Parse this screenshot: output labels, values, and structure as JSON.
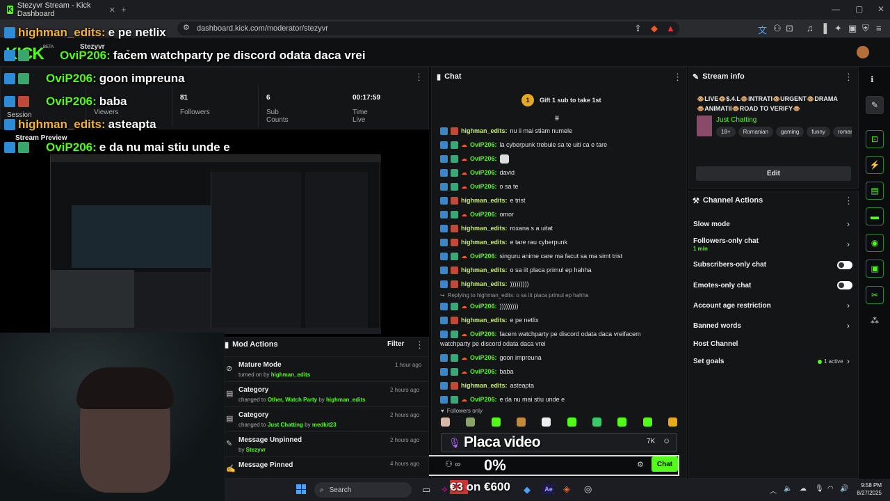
{
  "browser": {
    "tab_title": "Stezyvr Stream - Kick Dashboard",
    "url": "dashboard.kick.com/moderator/stezyvr"
  },
  "header": {
    "logo_text": "KICK",
    "beta": "BETA",
    "channel": "Stezyvr"
  },
  "session": {
    "label": "Session",
    "stats": [
      {
        "value": "",
        "label": "Viewers"
      },
      {
        "value": "81",
        "label": "Followers"
      },
      {
        "value": "6",
        "label": "Sub Counts"
      },
      {
        "value": "00:17:59",
        "label": "Time Live"
      }
    ]
  },
  "stream_preview": {
    "label": "Stream Preview"
  },
  "overlay_chat": [
    {
      "user": "highman_edits:",
      "text": "e pe netlix",
      "color": "orange"
    },
    {
      "user": "OviP206:",
      "text": "facem watchparty pe discord odata daca vrei",
      "color": "green"
    },
    {
      "user": "OviP206:",
      "text": "goon impreuna",
      "color": "green"
    },
    {
      "user": "OviP206:",
      "text": "baba",
      "color": "green"
    },
    {
      "user": "highman_edits:",
      "text": "asteapta",
      "color": "orange"
    },
    {
      "user": "OviP206:",
      "text": "e da nu mai stiu unde e",
      "color": "green"
    }
  ],
  "chat": {
    "title": "Chat",
    "gift_banner": "Gift 1 sub to take 1st",
    "gift_rank": "1",
    "messages": [
      {
        "user": "highman_edits:",
        "text": "nu ii mai stiam numele",
        "type": "y"
      },
      {
        "user": "OviP206:",
        "text": "la cyberpunk trebuie sa te uiti ca e tare",
        "type": "g"
      },
      {
        "user": "OviP206:",
        "text": "",
        "type": "g"
      },
      {
        "user": "OviP206:",
        "text": "david",
        "type": "g"
      },
      {
        "user": "OviP206:",
        "text": "o sa te",
        "type": "g"
      },
      {
        "user": "highman_edits:",
        "text": "e trist",
        "type": "y"
      },
      {
        "user": "OviP206:",
        "text": "omor",
        "type": "g"
      },
      {
        "user": "highman_edits:",
        "text": "roxana s a uitat",
        "type": "y"
      },
      {
        "user": "highman_edits:",
        "text": "e tare rau cyberpunk",
        "type": "y"
      },
      {
        "user": "OviP206:",
        "text": "singuru anime care ma facut sa ma simt trist",
        "type": "g"
      },
      {
        "user": "highman_edits:",
        "text": "o sa iit placa primul ep hahha",
        "type": "y"
      },
      {
        "user": "highman_edits:",
        "text": ")))))))))",
        "type": "y"
      }
    ],
    "reply_to": "Replying to highman_edits: o sa iit placa primul ep hahha",
    "reply_msg": {
      "user": "OviP206:",
      "text": ")))))))))"
    },
    "messages2": [
      {
        "user": "highman_edits:",
        "text": "e pe netlix",
        "type": "y"
      }
    ],
    "long_msg": {
      "user": "OviP206:",
      "line1": "facem watchparty pe discord odata daca vreifacem",
      "line2": "watchparty pe discord odata daca vrei"
    },
    "messages3": [
      {
        "user": "OviP206:",
        "text": "goon impreuna",
        "type": "g"
      },
      {
        "user": "OviP206:",
        "text": "baba",
        "type": "g"
      },
      {
        "user": "highman_edits:",
        "text": "asteapta",
        "type": "y"
      },
      {
        "user": "OviP206:",
        "text": "e da nu mai stiu unde e",
        "type": "g"
      }
    ],
    "followers_only": "Followers only",
    "send_label": "Chat"
  },
  "overlay_widgets": {
    "placa_video": "Placa video",
    "percent": "0%",
    "price": "€3 on €600"
  },
  "stream_info": {
    "title": "Stream info",
    "stream_title_line1": "🐵LIVE🐵$.4.L🐵INTRATI🐵URGENT🐵DRAMA",
    "stream_title_line2": "🐵ANIMATII🐵ROAD TO VERIFY🐵",
    "category": "Just Chatting",
    "tags": [
      "18+",
      "Romanian",
      "gaming",
      "funny",
      "roman"
    ],
    "edit_label": "Edit"
  },
  "channel_actions": {
    "title": "Channel Actions",
    "slow_mode": "Slow mode",
    "followers_only": "Followers-only chat",
    "followers_only_sub": "1 min",
    "subscribers_only": "Subscribers-only chat",
    "emotes_only": "Emotes-only chat",
    "account_age": "Account age restriction",
    "banned_words": "Banned words",
    "host_channel": "Host Channel",
    "set_goals": "Set goals",
    "goals_active": "1 active"
  },
  "mod_actions": {
    "title": "Mod Actions",
    "filter": "Filter",
    "items": [
      {
        "title": "Mature Mode",
        "prefix": "turned on by ",
        "detail": "",
        "by": "highman_edits",
        "time": "1 hour ago"
      },
      {
        "title": "Category",
        "prefix": "changed to ",
        "detail": "Other, Watch Party",
        "by": "highman_edits",
        "time": "2 hours ago"
      },
      {
        "title": "Category",
        "prefix": "changed to ",
        "detail": "Just Chatting",
        "by": "medkit23",
        "time": "2 hours ago"
      },
      {
        "title": "Message Unpinned",
        "prefix": "by ",
        "detail": "",
        "by": "Stezyvr",
        "time": "2 hours ago"
      },
      {
        "title": "Message Pinned",
        "prefix": "",
        "detail": "",
        "by": "",
        "time": "4 hours ago"
      }
    ]
  },
  "taskbar": {
    "search": "Search",
    "time": "9:58 PM",
    "date": "8/27/2025"
  }
}
